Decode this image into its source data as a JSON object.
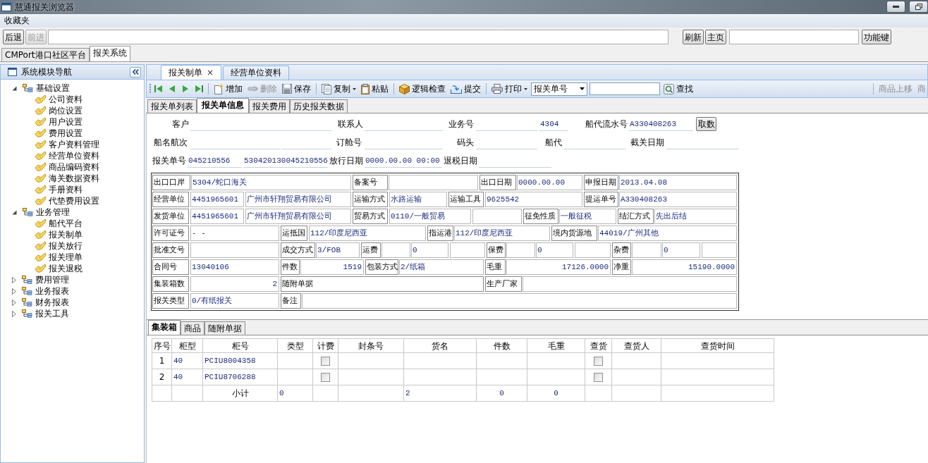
{
  "window": {
    "title": "慧通报关浏览器"
  },
  "menu": [
    "收藏夹"
  ],
  "nav_bar": [
    {
      "kind": "button",
      "label": "后退",
      "disabled": false
    },
    {
      "kind": "button",
      "label": "前进",
      "disabled": true
    },
    {
      "kind": "address"
    },
    {
      "kind": "button",
      "label": "刷新",
      "disabled": false
    },
    {
      "kind": "button",
      "label": "主页",
      "disabled": false
    },
    {
      "kind": "input"
    },
    {
      "kind": "button",
      "label": "功能键",
      "disabled": false
    }
  ],
  "app_tabs": [
    {
      "label": "CMPort港口社区平台",
      "selected": false
    },
    {
      "label": "报关系统",
      "selected": true
    }
  ],
  "sidebar": {
    "title": "系统模块导航",
    "tree": [
      {
        "label": "基础设置",
        "expanded": true,
        "children": [
          {
            "label": "公司资料"
          },
          {
            "label": "岗位设置"
          },
          {
            "label": "用户设置"
          },
          {
            "label": "费用设置"
          },
          {
            "label": "客户资料管理"
          },
          {
            "label": "经营单位资料"
          },
          {
            "label": "商品编码资料"
          },
          {
            "label": "海关数据资料"
          },
          {
            "label": "手册资料"
          },
          {
            "label": "代垫费用设置"
          }
        ]
      },
      {
        "label": "业务管理",
        "expanded": true,
        "children": [
          {
            "label": "船代平台"
          },
          {
            "label": "报关制单"
          },
          {
            "label": "报关放行"
          },
          {
            "label": "报关理单"
          },
          {
            "label": "报关退税"
          }
        ]
      },
      {
        "label": "费用管理",
        "expanded": false
      },
      {
        "label": "业务报表",
        "expanded": false
      },
      {
        "label": "财务报表",
        "expanded": false
      },
      {
        "label": "报关工具",
        "expanded": false
      }
    ]
  },
  "doc_tabs": [
    {
      "label": "报关制单",
      "selected": true,
      "close": "×"
    },
    {
      "label": "经营单位资料",
      "selected": false
    }
  ],
  "toolbar": [
    {
      "kind": "nav"
    },
    {
      "kind": "nav"
    },
    {
      "kind": "nav"
    },
    {
      "kind": "nav"
    },
    {
      "kind": "separator"
    },
    {
      "kind": "button",
      "label": "增加",
      "disabled": false
    },
    {
      "kind": "button",
      "label": "删除",
      "disabled": true
    },
    {
      "kind": "button",
      "label": "保存",
      "disabled": false
    },
    {
      "kind": "separator"
    },
    {
      "kind": "menu",
      "label": "复制",
      "disabled": false
    },
    {
      "kind": "button",
      "label": "粘贴",
      "disabled": false
    },
    {
      "kind": "separator"
    },
    {
      "kind": "button",
      "label": "逻辑检查",
      "disabled": false
    },
    {
      "kind": "button",
      "label": "提交",
      "disabled": false
    },
    {
      "kind": "separator"
    },
    {
      "kind": "menu",
      "label": "打印",
      "disabled": false
    },
    {
      "kind": "select",
      "value": "报关单号"
    },
    {
      "kind": "input"
    },
    {
      "kind": "button",
      "label": "查找",
      "disabled": false
    },
    {
      "kind": "spacer"
    },
    {
      "kind": "separator"
    },
    {
      "kind": "text_button",
      "label": "商品上移",
      "disabled": true
    },
    {
      "kind": "text_button",
      "label": "商",
      "disabled": true
    }
  ],
  "sub_tabs": [
    {
      "label": "报关单列表",
      "selected": false
    },
    {
      "label": "报关单信息",
      "selected": true
    },
    {
      "label": "报关费用",
      "selected": false
    },
    {
      "label": "历史报关数据",
      "selected": false
    }
  ],
  "header_form": [
    [
      {
        "kind": "label",
        "text": "客户"
      },
      {
        "kind": "field"
      },
      {
        "kind": "label",
        "text": "联系人"
      },
      {
        "kind": "field"
      },
      {
        "kind": "label",
        "text": "业务号"
      },
      {
        "kind": "field"
      },
      {
        "kind": "field",
        "value": "4304"
      },
      {
        "kind": "label",
        "text": "船代流水号"
      },
      {
        "kind": "field",
        "value": "A330408263"
      },
      {
        "kind": "button",
        "text": "取数"
      }
    ],
    [
      {
        "kind": "label",
        "text": "船名航次"
      },
      {
        "kind": "field"
      },
      {
        "kind": "field"
      },
      {
        "kind": "label",
        "text": "订舱号"
      },
      {
        "kind": "field"
      },
      {
        "kind": "label",
        "text": "码头"
      },
      {
        "kind": "field"
      },
      {
        "kind": "label",
        "text": "船代"
      },
      {
        "kind": "field"
      },
      {
        "kind": "label",
        "text": "截关日期"
      },
      {
        "kind": "field"
      }
    ],
    [
      {
        "kind": "label",
        "text": "报关单号"
      },
      {
        "kind": "field",
        "value": "045210556"
      },
      {
        "kind": "field",
        "value": "530420130045210556"
      },
      {
        "kind": "label",
        "text": "放行日期"
      },
      {
        "kind": "field",
        "value": "0000.00.00 00:00"
      },
      {
        "kind": "label",
        "text": "退税日期"
      },
      {
        "kind": "field"
      }
    ]
  ],
  "declaration_grid": [
    [
      {
        "kind": "label",
        "text": "出口口岸"
      },
      {
        "kind": "value",
        "text": "5304/蛇口海关"
      },
      {
        "kind": "label",
        "text": "备案号"
      },
      {
        "kind": "value"
      },
      {
        "kind": "label",
        "text": "出口日期"
      },
      {
        "kind": "value",
        "text": "0000.00.00"
      },
      {
        "kind": "label",
        "text": "申报日期"
      },
      {
        "kind": "value",
        "text": "2013.04.08"
      }
    ],
    [
      {
        "kind": "label",
        "text": "经营单位"
      },
      {
        "kind": "value",
        "text": "4451965601"
      },
      {
        "kind": "value",
        "text": "广州市轩翔贸易有限公司"
      },
      {
        "kind": "label",
        "text": "运输方式"
      },
      {
        "kind": "value",
        "text": "水路运输"
      },
      {
        "kind": "label",
        "text": "运输工具"
      },
      {
        "kind": "value",
        "text": "9625542"
      },
      {
        "kind": "label",
        "text": "提运单号"
      },
      {
        "kind": "value",
        "text": "A330408263"
      }
    ],
    [
      {
        "kind": "label",
        "text": "发货单位"
      },
      {
        "kind": "value",
        "text": "4451965601"
      },
      {
        "kind": "value",
        "text": "广州市轩翔贸易有限公司"
      },
      {
        "kind": "label",
        "text": "贸易方式"
      },
      {
        "kind": "value",
        "text": "0110/一般贸易"
      },
      {
        "kind": "value"
      },
      {
        "kind": "label",
        "text": "征免性质"
      },
      {
        "kind": "value",
        "text": "一般征税"
      },
      {
        "kind": "label",
        "text": "结汇方式"
      },
      {
        "kind": "value",
        "text": "先出后结"
      }
    ],
    [
      {
        "kind": "label",
        "text": "许可证号"
      },
      {
        "kind": "value",
        "text": "-  -"
      },
      {
        "kind": "label",
        "text": "运抵国"
      },
      {
        "kind": "value",
        "text": "112/印度尼西亚"
      },
      {
        "kind": "label",
        "text": "指运港"
      },
      {
        "kind": "value",
        "text": "112/印度尼西亚"
      },
      {
        "kind": "label",
        "text": "境内货源地"
      },
      {
        "kind": "value",
        "text": "44019/广州其他"
      }
    ],
    [
      {
        "kind": "label",
        "text": "批准文号"
      },
      {
        "kind": "value"
      },
      {
        "kind": "label",
        "text": "成交方式"
      },
      {
        "kind": "value",
        "text": "3/FOB"
      },
      {
        "kind": "label",
        "text": "运费"
      },
      {
        "kind": "value"
      },
      {
        "kind": "value",
        "text": "0"
      },
      {
        "kind": "value"
      },
      {
        "kind": "label",
        "text": "保费"
      },
      {
        "kind": "value"
      },
      {
        "kind": "value",
        "text": "0"
      },
      {
        "kind": "value"
      },
      {
        "kind": "label",
        "text": "杂费"
      },
      {
        "kind": "value"
      },
      {
        "kind": "value",
        "text": "0"
      },
      {
        "kind": "value"
      }
    ],
    [
      {
        "kind": "label",
        "text": "合同号"
      },
      {
        "kind": "value",
        "text": "13040106"
      },
      {
        "kind": "label",
        "text": "件数"
      },
      {
        "kind": "number",
        "text": "1519"
      },
      {
        "kind": "label",
        "text": "包装方式"
      },
      {
        "kind": "value",
        "text": "2/纸箱"
      },
      {
        "kind": "label",
        "text": "毛重"
      },
      {
        "kind": "number",
        "text": "17126.0000"
      },
      {
        "kind": "label",
        "text": "净重"
      },
      {
        "kind": "number",
        "text": "15190.0000"
      }
    ],
    [
      {
        "kind": "label",
        "text": "集装箱数"
      },
      {
        "kind": "number",
        "text": "2"
      },
      {
        "kind": "label",
        "text": "随附单据"
      },
      {
        "kind": "label",
        "text": "生产厂家"
      },
      {
        "kind": "value"
      }
    ],
    [
      {
        "kind": "label",
        "text": "报关类型"
      },
      {
        "kind": "value",
        "text": "0/有纸报关"
      },
      {
        "kind": "label",
        "text": "备注"
      },
      {
        "kind": "value"
      }
    ]
  ],
  "bottom_tabs": [
    {
      "label": "集装箱",
      "selected": true
    },
    {
      "label": "商品",
      "selected": false
    },
    {
      "label": "随附单据",
      "selected": false
    }
  ],
  "containers": {
    "columns": [
      "序号",
      "柜型",
      "柜号",
      "类型",
      "计费",
      "封条号",
      "货名",
      "件数",
      "毛重",
      "查货",
      "查货人",
      "查货时间"
    ],
    "rows": [
      {
        "kind": "item",
        "seq": "1",
        "cabinet_type": "40",
        "cabinet_no": "PCIU8004358",
        "billable": false,
        "inspected": false
      },
      {
        "kind": "item",
        "seq": "2",
        "cabinet_type": "40",
        "cabinet_no": "PCIU8706288",
        "billable": false,
        "inspected": false
      },
      {
        "kind": "subtotal",
        "label": "小计",
        "type": "0",
        "goods": "2",
        "pieces": "0",
        "weight": "0"
      }
    ]
  }
}
